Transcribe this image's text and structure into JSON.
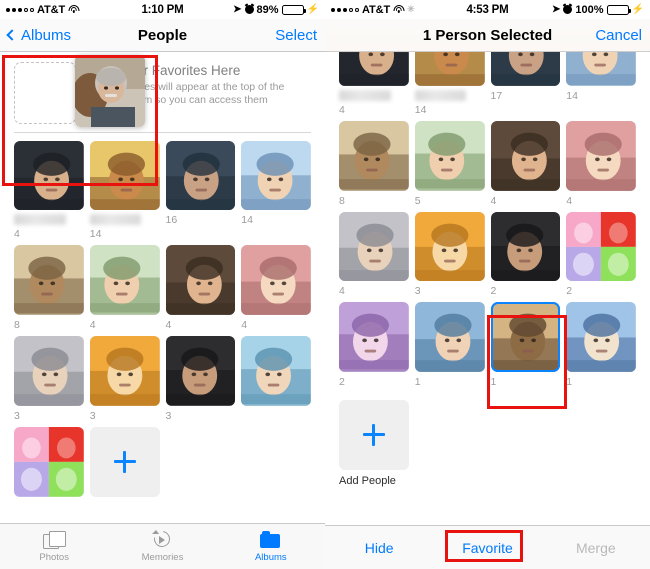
{
  "left_phone": {
    "status_bar": {
      "carrier": "AT&T",
      "signal_dots": "●●●○○",
      "wifi_icon": "wifi-icon",
      "time": "1:10 PM",
      "location_icon": "location-arrow-icon",
      "alarm_icon": "alarm-clock-icon",
      "battery_percent": "89%",
      "battery_icon": "battery-icon",
      "charging_icon": "lightning-bolt-icon"
    },
    "nav_bar": {
      "back_label": "Albums",
      "back_icon": "chevron-left-icon",
      "title": "People",
      "action_label": "Select"
    },
    "favorites_banner": {
      "drop_target": "favorites-drop-target",
      "title": "Drag Your Favorites Here",
      "description": "Your Favorites will appear at the top of the People album so you can access them quickly."
    },
    "drag_preview": "dragged-person-thumbnail",
    "people_grid": [
      {
        "name_hidden": true,
        "count": "4"
      },
      {
        "name_hidden": true,
        "count": "14"
      },
      {
        "name_hidden": false,
        "count": "16"
      },
      {
        "name_hidden": false,
        "count": "14"
      },
      {
        "name_hidden": false,
        "count": "8"
      },
      {
        "name_hidden": false,
        "count": "4"
      },
      {
        "name_hidden": false,
        "count": "4"
      },
      {
        "name_hidden": false,
        "count": "4"
      },
      {
        "name_hidden": false,
        "count": "3"
      },
      {
        "name_hidden": false,
        "count": "3"
      },
      {
        "name_hidden": false,
        "count": "3"
      },
      {
        "name_hidden": false,
        "count": ""
      },
      {
        "name_hidden": false,
        "count": ""
      },
      {
        "name_hidden": false,
        "count": ""
      }
    ],
    "add_people": {
      "label": "",
      "icon": "plus-icon"
    },
    "tab_bar": [
      {
        "label": "Photos",
        "icon": "photos-icon",
        "active": false
      },
      {
        "label": "Memories",
        "icon": "memories-icon",
        "active": false
      },
      {
        "label": "Albums",
        "icon": "albums-icon",
        "active": true
      }
    ],
    "annotation_boxes": 1
  },
  "right_phone": {
    "status_bar": {
      "carrier": "AT&T",
      "signal_dots": "●●●○○",
      "wifi_icon": "wifi-icon",
      "extra_icon": "snowflake-icon",
      "time": "4:53 PM",
      "location_icon": "location-arrow-icon",
      "alarm_icon": "alarm-clock-icon",
      "battery_percent": "100%",
      "battery_icon": "battery-icon",
      "charging_icon": "lightning-bolt-icon"
    },
    "nav_bar": {
      "title": "1 Person Selected",
      "action_label": "Cancel"
    },
    "people_grid": [
      {
        "name_hidden": true,
        "count": "4",
        "selected": false
      },
      {
        "name_hidden": true,
        "count": "14",
        "selected": false
      },
      {
        "name_hidden": false,
        "count": "17",
        "selected": false
      },
      {
        "name_hidden": false,
        "count": "14",
        "selected": false
      },
      {
        "name_hidden": false,
        "count": "8",
        "selected": false
      },
      {
        "name_hidden": false,
        "count": "5",
        "selected": false
      },
      {
        "name_hidden": false,
        "count": "4",
        "selected": false
      },
      {
        "name_hidden": false,
        "count": "4",
        "selected": false
      },
      {
        "name_hidden": false,
        "count": "4",
        "selected": false
      },
      {
        "name_hidden": false,
        "count": "3",
        "selected": false
      },
      {
        "name_hidden": false,
        "count": "2",
        "selected": false
      },
      {
        "name_hidden": false,
        "count": "2",
        "selected": false
      },
      {
        "name_hidden": false,
        "count": "2",
        "selected": false
      },
      {
        "name_hidden": false,
        "count": "1",
        "selected": false
      },
      {
        "name_hidden": false,
        "count": "1",
        "selected": true
      },
      {
        "name_hidden": false,
        "count": "1",
        "selected": false
      }
    ],
    "add_people": {
      "label": "Add People",
      "icon": "plus-icon"
    },
    "action_bar": {
      "hide_label": "Hide",
      "favorite_label": "Favorite",
      "merge_label": "Merge",
      "merge_disabled": true
    },
    "annotation_boxes": 2
  },
  "colors": {
    "accent_blue": "#007AFF",
    "selection_blue": "#0a84ff",
    "annotation_red": "#e8120e",
    "battery_green": "#4cd964",
    "disabled_gray": "#b9b9b9"
  }
}
